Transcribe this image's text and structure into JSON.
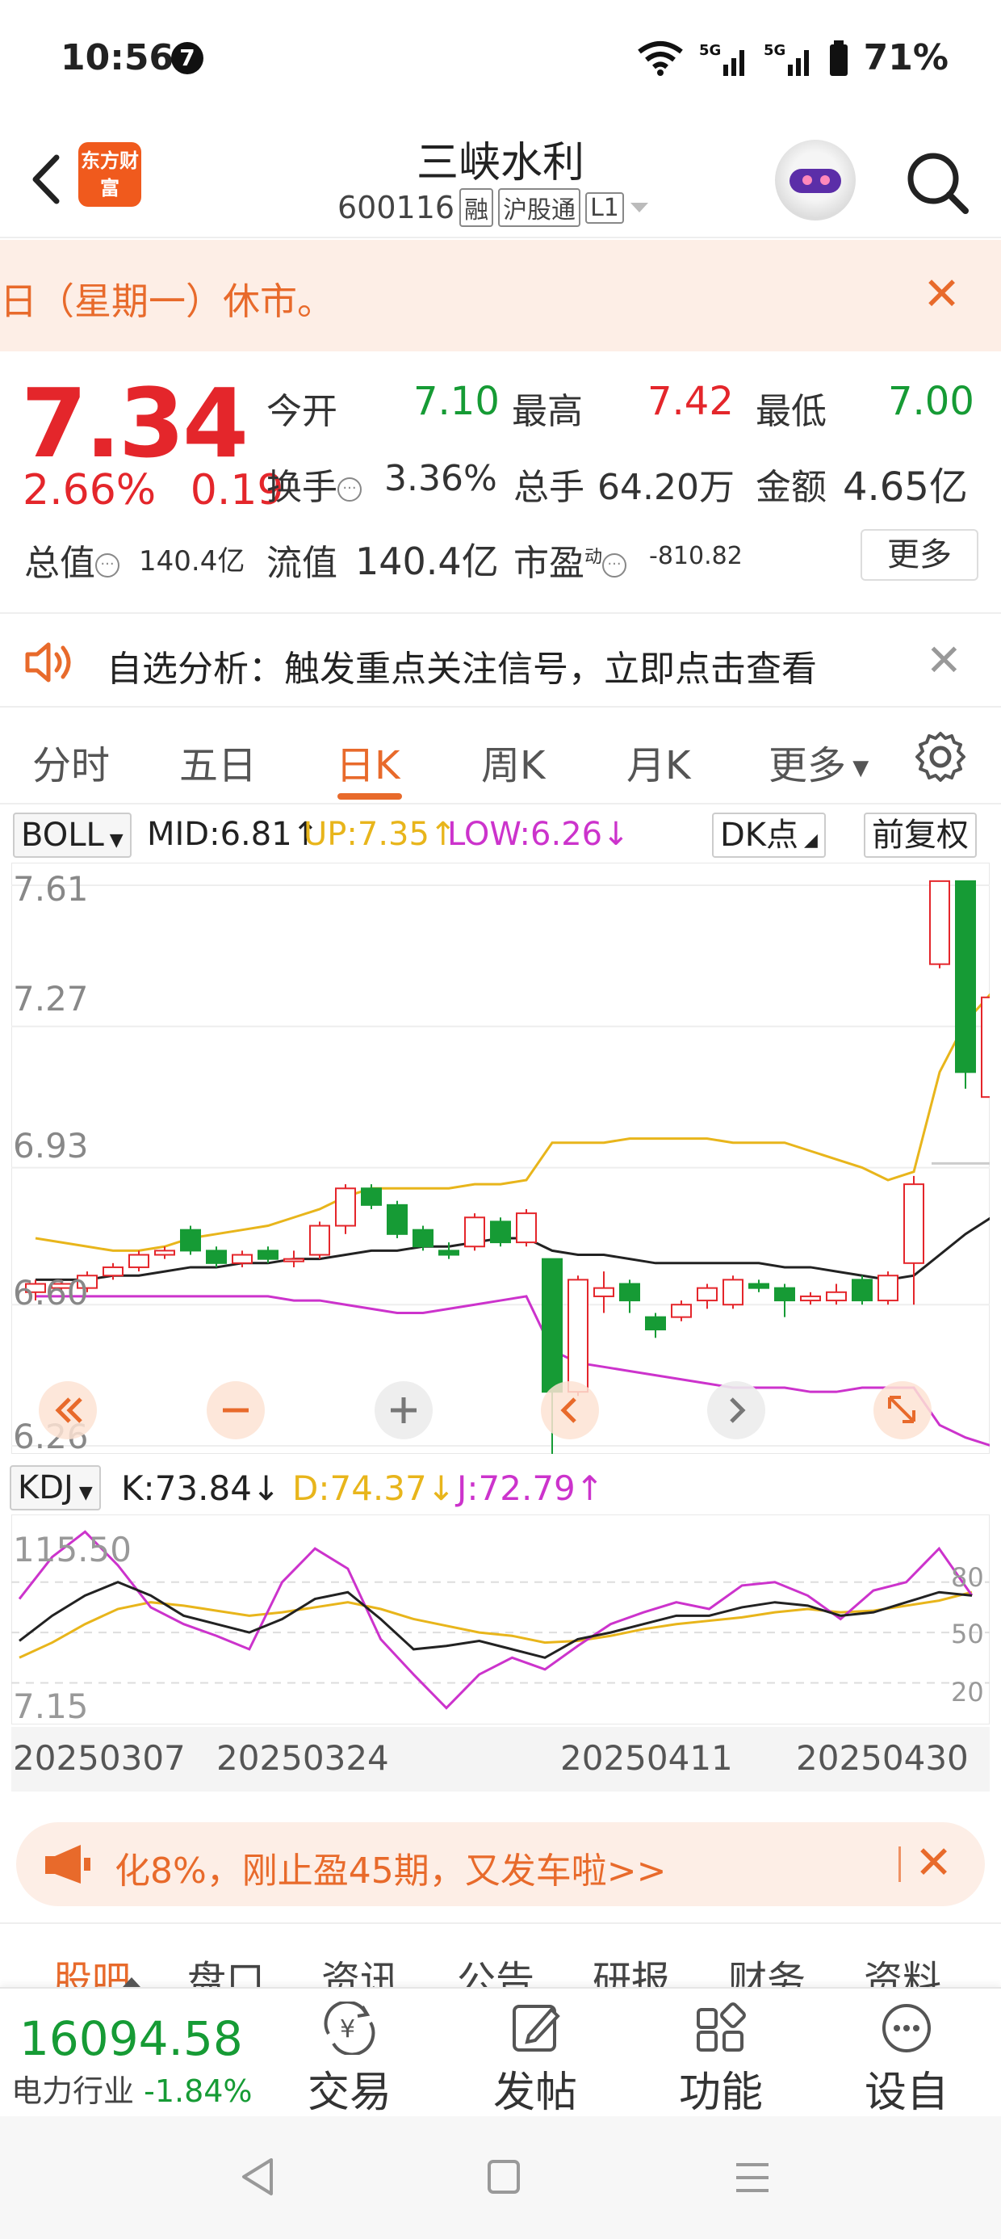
{
  "status_bar": {
    "time": "10:56",
    "notification_count": "7",
    "battery": "71%"
  },
  "header": {
    "brand": "东方财富",
    "stock_name": "三峡水利",
    "stock_code": "600116",
    "tags": [
      "融",
      "沪股通",
      "L1"
    ]
  },
  "notice": {
    "text": "日（星期一）休市。"
  },
  "quote": {
    "price": "7.34",
    "change_pct": "2.66%",
    "change_amt": "0.19",
    "open_label": "今开",
    "open": "7.10",
    "high_label": "最高",
    "high": "7.42",
    "low_label": "最低",
    "low": "7.00",
    "turnover_label": "换手",
    "turnover": "3.36%",
    "volume_label": "总手",
    "volume": "64.20万",
    "amount_label": "金额",
    "amount": "4.65亿",
    "mcap_label": "总值",
    "mcap": "140.4亿",
    "float_label": "流值",
    "float": "140.4亿",
    "pe_label": "市盈",
    "pe_sup": "动",
    "pe": "-810.82",
    "more": "更多"
  },
  "analysis": {
    "text": "自选分析：触发重点关注信号，立即点击查看"
  },
  "tabs": [
    "分时",
    "五日",
    "日K",
    "周K",
    "月K",
    "更多"
  ],
  "active_tab": "日K",
  "indicator": {
    "name": "BOLL",
    "mid": "MID:6.81↑",
    "up": "UP:7.35↑",
    "low": "LOW:6.26↓",
    "dk": "DK点",
    "adjust": "前复权"
  },
  "price_axis": [
    "7.61",
    "7.27",
    "6.93",
    "6.60",
    "6.26"
  ],
  "kdj": {
    "name": "KDJ",
    "k": "K:73.84↓",
    "d": "D:74.37↓",
    "j": "J:72.79↑",
    "axis_left": [
      "115.50",
      "7.15"
    ],
    "axis_right": [
      "80",
      "50",
      "20"
    ]
  },
  "dates": [
    "20250307",
    "20250324",
    "20250411",
    "20250430"
  ],
  "promo": {
    "text": "化8%，刚止盈45期，又发车啦>>"
  },
  "subtabs": [
    "股吧",
    "盘口",
    "资讯",
    "公告",
    "研报",
    "财务",
    "资料"
  ],
  "bottom": {
    "index_value": "16094.58",
    "index_name": "电力行业",
    "index_change": "-1.84%",
    "tools": [
      "交易",
      "发帖",
      "功能",
      "设自选"
    ]
  },
  "colors": {
    "up": "#e4262b",
    "down": "#169b35",
    "accent": "#e86a2b",
    "mid": "#222222",
    "upper": "#e8b51b",
    "lower": "#cc33cc"
  },
  "chart_data": {
    "type": "candlestick",
    "title": "",
    "ylim": [
      6.26,
      7.61
    ],
    "candles": [
      {
        "o": 6.63,
        "c": 6.65,
        "h": 6.66,
        "l": 6.61
      },
      {
        "o": 6.64,
        "c": 6.65,
        "h": 6.66,
        "l": 6.63
      },
      {
        "o": 6.64,
        "c": 6.67,
        "h": 6.68,
        "l": 6.63
      },
      {
        "o": 6.67,
        "c": 6.69,
        "h": 6.7,
        "l": 6.66
      },
      {
        "o": 6.69,
        "c": 6.72,
        "h": 6.73,
        "l": 6.68
      },
      {
        "o": 6.72,
        "c": 6.73,
        "h": 6.74,
        "l": 6.71
      },
      {
        "o": 6.78,
        "c": 6.73,
        "h": 6.79,
        "l": 6.72
      },
      {
        "o": 6.73,
        "c": 6.7,
        "h": 6.74,
        "l": 6.69
      },
      {
        "o": 6.7,
        "c": 6.72,
        "h": 6.73,
        "l": 6.69
      },
      {
        "o": 6.73,
        "c": 6.71,
        "h": 6.74,
        "l": 6.7
      },
      {
        "o": 6.71,
        "c": 6.71,
        "h": 6.73,
        "l": 6.69
      },
      {
        "o": 6.72,
        "c": 6.79,
        "h": 6.8,
        "l": 6.71
      },
      {
        "o": 6.79,
        "c": 6.88,
        "h": 6.89,
        "l": 6.77
      },
      {
        "o": 6.88,
        "c": 6.84,
        "h": 6.89,
        "l": 6.83
      },
      {
        "o": 6.84,
        "c": 6.77,
        "h": 6.85,
        "l": 6.76
      },
      {
        "o": 6.78,
        "c": 6.74,
        "h": 6.79,
        "l": 6.73
      },
      {
        "o": 6.73,
        "c": 6.72,
        "h": 6.75,
        "l": 6.71
      },
      {
        "o": 6.74,
        "c": 6.81,
        "h": 6.82,
        "l": 6.73
      },
      {
        "o": 6.8,
        "c": 6.75,
        "h": 6.81,
        "l": 6.74
      },
      {
        "o": 6.75,
        "c": 6.82,
        "h": 6.83,
        "l": 6.74
      },
      {
        "o": 6.71,
        "c": 6.39,
        "h": 6.71,
        "l": 6.22
      },
      {
        "o": 6.39,
        "c": 6.66,
        "h": 6.67,
        "l": 6.38
      },
      {
        "o": 6.62,
        "c": 6.64,
        "h": 6.68,
        "l": 6.58
      },
      {
        "o": 6.65,
        "c": 6.61,
        "h": 6.66,
        "l": 6.58
      },
      {
        "o": 6.57,
        "c": 6.54,
        "h": 6.58,
        "l": 6.52
      },
      {
        "o": 6.57,
        "c": 6.6,
        "h": 6.61,
        "l": 6.56
      },
      {
        "o": 6.61,
        "c": 6.64,
        "h": 6.65,
        "l": 6.59
      },
      {
        "o": 6.6,
        "c": 6.66,
        "h": 6.67,
        "l": 6.59
      },
      {
        "o": 6.65,
        "c": 6.64,
        "h": 6.66,
        "l": 6.63
      },
      {
        "o": 6.64,
        "c": 6.61,
        "h": 6.65,
        "l": 6.57
      },
      {
        "o": 6.61,
        "c": 6.62,
        "h": 6.63,
        "l": 6.6
      },
      {
        "o": 6.61,
        "c": 6.63,
        "h": 6.65,
        "l": 6.6
      },
      {
        "o": 6.66,
        "c": 6.61,
        "h": 6.67,
        "l": 6.6
      },
      {
        "o": 6.61,
        "c": 6.67,
        "h": 6.68,
        "l": 6.6
      },
      {
        "o": 6.7,
        "c": 6.89,
        "h": 6.91,
        "l": 6.6
      },
      {
        "o": 7.42,
        "c": 7.62,
        "h": 7.62,
        "l": 7.41
      },
      {
        "o": 7.62,
        "c": 7.16,
        "h": 7.62,
        "l": 7.12
      },
      {
        "o": 7.1,
        "c": 7.34,
        "h": 7.42,
        "l": 7.0
      }
    ],
    "boll_mid": [
      6.66,
      6.66,
      6.66,
      6.67,
      6.67,
      6.68,
      6.69,
      6.69,
      6.7,
      6.7,
      6.71,
      6.71,
      6.72,
      6.73,
      6.73,
      6.74,
      6.74,
      6.75,
      6.76,
      6.76,
      6.73,
      6.72,
      6.72,
      6.71,
      6.7,
      6.7,
      6.7,
      6.7,
      6.7,
      6.69,
      6.69,
      6.68,
      6.67,
      6.66,
      6.67,
      6.72,
      6.77,
      6.81
    ],
    "boll_up": [
      6.76,
      6.75,
      6.74,
      6.73,
      6.73,
      6.74,
      6.76,
      6.77,
      6.78,
      6.79,
      6.81,
      6.83,
      6.86,
      6.88,
      6.88,
      6.88,
      6.88,
      6.89,
      6.89,
      6.9,
      6.99,
      6.99,
      6.99,
      7.0,
      7.0,
      7.0,
      7.0,
      6.99,
      6.99,
      6.99,
      6.97,
      6.95,
      6.93,
      6.9,
      6.92,
      7.16,
      7.28,
      7.35
    ],
    "boll_low": [
      6.62,
      6.62,
      6.62,
      6.62,
      6.62,
      6.62,
      6.62,
      6.62,
      6.62,
      6.62,
      6.61,
      6.61,
      6.6,
      6.59,
      6.58,
      6.58,
      6.59,
      6.6,
      6.61,
      6.62,
      6.49,
      6.46,
      6.45,
      6.44,
      6.43,
      6.42,
      6.41,
      6.4,
      6.4,
      6.4,
      6.39,
      6.39,
      6.4,
      6.4,
      6.4,
      6.31,
      6.28,
      6.26
    ],
    "kdj_k": [
      45,
      60,
      72,
      80,
      72,
      60,
      55,
      50,
      58,
      70,
      74,
      58,
      40,
      42,
      45,
      40,
      35,
      46,
      50,
      55,
      60,
      60,
      65,
      68,
      66,
      60,
      62,
      68,
      74,
      72
    ],
    "kdj_d": [
      35,
      44,
      55,
      64,
      68,
      66,
      63,
      60,
      62,
      65,
      68,
      64,
      58,
      54,
      50,
      48,
      44,
      45,
      48,
      52,
      55,
      57,
      59,
      62,
      64,
      62,
      63,
      66,
      69,
      74
    ],
    "kdj_j": [
      70,
      95,
      110,
      90,
      65,
      55,
      48,
      40,
      80,
      100,
      88,
      46,
      25,
      5,
      25,
      35,
      28,
      42,
      55,
      62,
      68,
      64,
      78,
      80,
      72,
      58,
      75,
      80,
      100,
      72
    ]
  }
}
